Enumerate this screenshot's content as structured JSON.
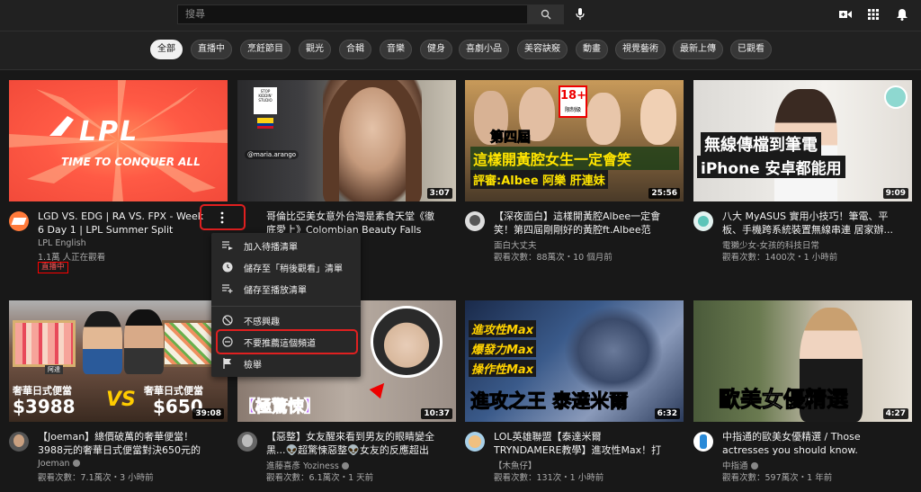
{
  "header": {
    "search_placeholder": "搜尋",
    "icons": [
      "search-icon",
      "mic-icon",
      "create-video-icon",
      "apps-icon",
      "notifications-icon"
    ]
  },
  "chips": [
    "全部",
    "直播中",
    "烹飪節目",
    "觀光",
    "合輯",
    "音樂",
    "健身",
    "喜劇小品",
    "美容訣竅",
    "動畫",
    "視覺藝術",
    "最新上傳",
    "已觀看"
  ],
  "menu": {
    "items": [
      "加入待播清單",
      "儲存至「稍後觀看」清單",
      "儲存至播放清單",
      "不感興趣",
      "不要推薦這個頻道",
      "檢舉"
    ]
  },
  "videos": [
    {
      "title": "LGD VS. EDG | RA VS. FPX - Week 6 Day 1 | LPL Summer Split (2021)",
      "channel": "LPL English",
      "stats": "1.1萬 人正在觀看",
      "badge": "直播中",
      "thumb_text_1": "LPL",
      "thumb_text_2": "TIME TO CONQUER ALL"
    },
    {
      "title": "哥倫比亞美女意外台灣是素食天堂《徹底愛上》Colombian Beauty Falls In...",
      "duration": "3:07",
      "thumb_text_1": "STOP KIDDIN' STUDIO",
      "thumb_text_2": "@maria.arango"
    },
    {
      "title": "【深夜面白】這樣開黃腔Albee一定會笑！第四屆剛剛好的黃腔ft.Albee范乙...",
      "channel": "面白大丈夫",
      "stats": "觀看次數：88萬次・10 個月前",
      "duration": "25:56",
      "thumb_text_1": "18+",
      "thumb_text_2": "限制級",
      "thumb_text_3": "第四屆",
      "thumb_text_4": "這樣開黃腔女生一定會笑",
      "thumb_text_5": "評審:Albee 阿樂 肝連妹"
    },
    {
      "title": "八大 MyASUS 實用小技巧！筆電、平板、手機跨系統裝置無線串連 居家辦...",
      "channel": "電獺少女-女孩的科技日常",
      "stats": "觀看次數：1400次・1 小時前",
      "duration": "9:09",
      "thumb_text_1": "無線傳檔到筆電",
      "thumb_text_2": "iPhone 安卓都能用"
    },
    {
      "title": "【Joeman】總價破萬的奢華便當！3988元的奢華日式便當對決650元的奢...",
      "channel": "Joeman",
      "stats": "觀看次數：7.1萬次・3 小時前",
      "duration": "39:08",
      "thumb_text_1": "奢華日式便當",
      "thumb_text_2": "$3988",
      "thumb_text_3": "VS",
      "thumb_text_4": "奢華日式便當",
      "thumb_text_5": "$650",
      "thumb_text_6": "阿達"
    },
    {
      "title": "【惡整】女友醒來看到男友的眼睛變全黑...👽超驚悚惡整👽女友的反應超出我...",
      "channel": "進藤喜彥 Yoziness",
      "stats": "觀看次數：6.1萬次・1 天前",
      "duration": "10:37",
      "thumb_text_1": "【極驚悚】"
    },
    {
      "title": "LOL英雄聯盟【泰達米爾TRYNDAMERE教學】進攻性Max！打架爬分泰達米...",
      "channel": "【木魚仔】",
      "stats": "觀看次數：131次・1 小時前",
      "duration": "6:32",
      "thumb_text_1": "進攻性Max",
      "thumb_text_2": "爆發力Max",
      "thumb_text_3": "操作性Max",
      "thumb_text_4": "進攻之王 泰達米爾"
    },
    {
      "title": "中指通的歐美女優精選 / Those actresses you should know.",
      "channel": "中指通",
      "stats": "觀看次數：597萬次・1 年前",
      "duration": "4:27",
      "thumb_text_1": "歐美女優精選"
    }
  ]
}
